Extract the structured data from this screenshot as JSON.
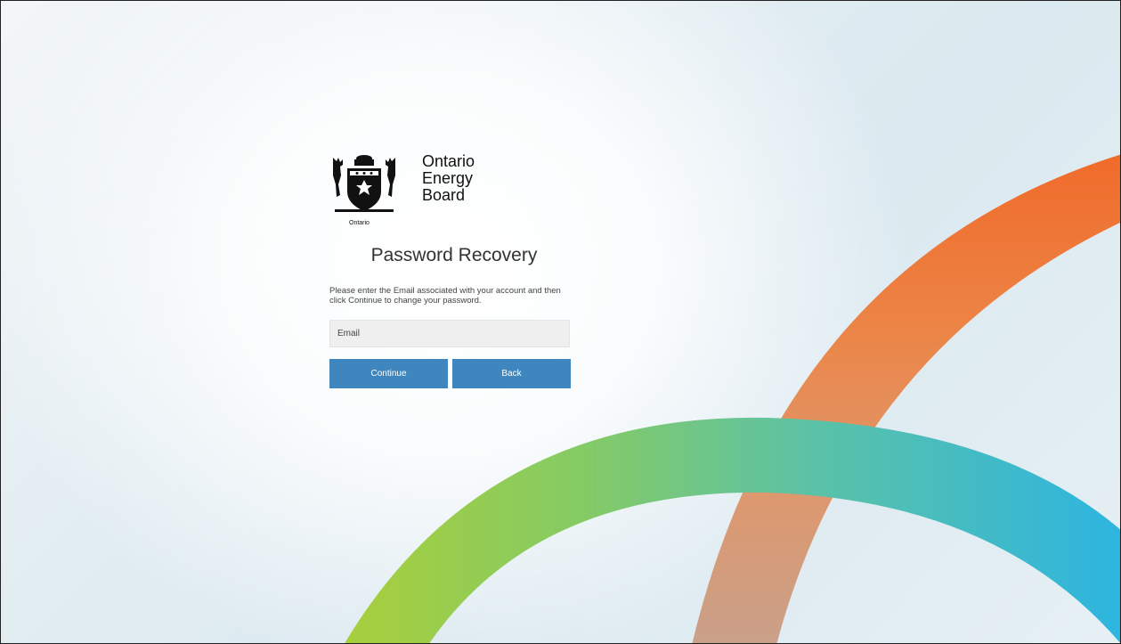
{
  "organization": {
    "name_lines": [
      "Ontario",
      "Energy",
      "Board"
    ],
    "crest_caption": "Ontario",
    "crest_icon": "ontario-coat-of-arms"
  },
  "recovery": {
    "title": "Password Recovery",
    "instructions": "Please enter the Email associated with your account and then click Continue to change your password.",
    "email_placeholder": "Email",
    "email_value": "",
    "continue_label": "Continue",
    "back_label": "Back"
  },
  "colors": {
    "button": "#3e86bd",
    "arc_orange": "#ef6c2c",
    "arc_green": "#9ccc3f",
    "arc_teal": "#4bbfc0",
    "arc_blue": "#2db6e0"
  }
}
